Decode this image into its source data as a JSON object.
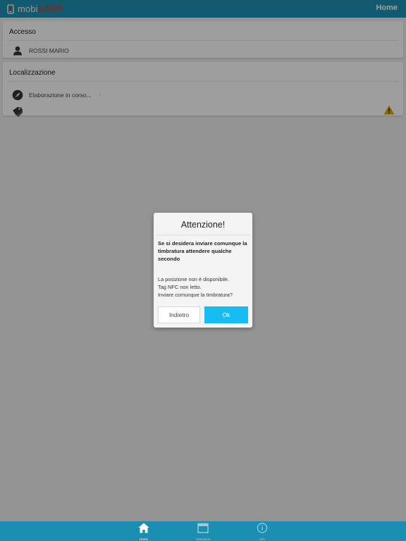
{
  "header": {
    "logo": {
      "prefix": "mobi",
      "brand": "SARP"
    },
    "home_label": "Home"
  },
  "access_card": {
    "title": "Accesso",
    "user_name": "ROSSI MARIO"
  },
  "location_card": {
    "title": "Localizzazione",
    "status": "Elaborazione in corso...",
    "dot": "-"
  },
  "dialog": {
    "title": "Attenzione!",
    "bold_message": "Se si desidera inviare comunque la timbratura attendere qualche secondo",
    "lines": [
      "La posizione non è disponibile.",
      "Tag NFC non letto.",
      "Inviare comunque la timbratura?"
    ],
    "back_label": "Indietro",
    "ok_label": "Ok"
  },
  "tabbar": {
    "tabs": [
      {
        "label": "Home",
        "icon": "home-icon"
      },
      {
        "label": "Timbrature",
        "icon": "calendar-icon"
      },
      {
        "label": "Info",
        "icon": "info-icon"
      }
    ]
  },
  "colors": {
    "bar": "#1b8fb2",
    "ok_button": "#17bdf0",
    "brand_red": "#d6382b",
    "warning": "#d4a900"
  }
}
